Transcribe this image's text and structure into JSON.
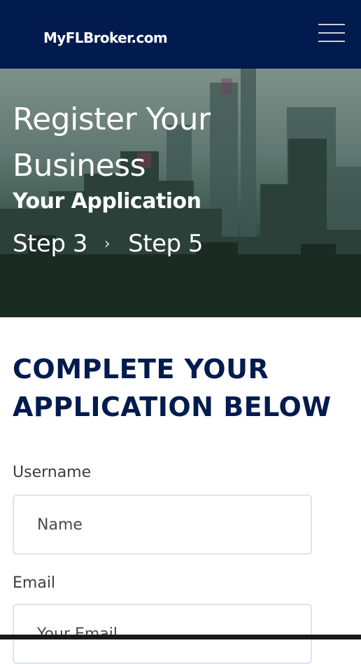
{
  "header": {
    "logo_text": "MyFLBroker.com",
    "menu_icon": "hamburger-icon"
  },
  "hero": {
    "title": "Register Your Business",
    "subtitle": "Your Application",
    "step_current": "Step 3",
    "step_separator": "›",
    "step_total": "Step 5"
  },
  "form": {
    "heading": "COMPLETE YOUR APPLICATION BELOW",
    "username_label": "Username",
    "username_placeholder": "Name",
    "email_label": "Email",
    "email_placeholder": "Your Email"
  },
  "colors": {
    "brand_navy": "#011b4e",
    "field_border": "#e0e3ee"
  }
}
